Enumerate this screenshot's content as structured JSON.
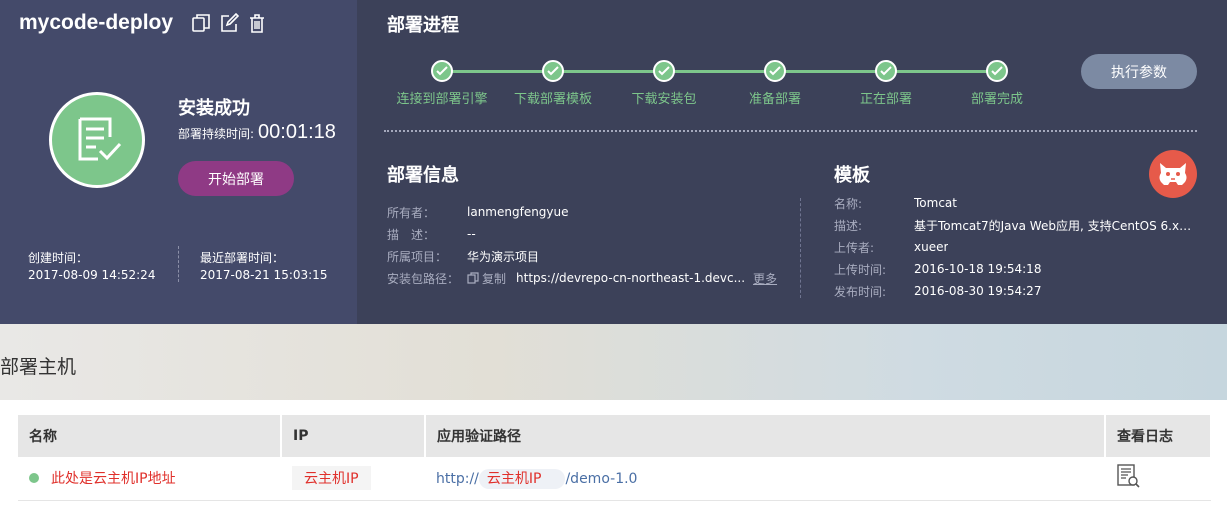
{
  "app": {
    "title": "mycode-deploy",
    "icons": [
      "copy-icon",
      "edit-icon",
      "trash-icon"
    ]
  },
  "status": {
    "title": "安装成功",
    "duration_label": "部署持续时间:",
    "duration_value": "00:01:18",
    "deploy_button": "开始部署",
    "created_label": "创建时间：",
    "created_value": "2017-08-09 14:52:24",
    "last_label": "最近部署时间：",
    "last_value": "2017-08-21 15:03:15"
  },
  "progress": {
    "title": "部署进程",
    "steps": [
      "连接到部署引擎",
      "下载部署模板",
      "下载安装包",
      "准备部署",
      "正在部署",
      "部署完成"
    ],
    "exec_button": "执行参数"
  },
  "info": {
    "title": "部署信息",
    "owner_label": "所有者：",
    "owner_value": "lanmengfengyue",
    "desc_label": "描　述：",
    "desc_value": "--",
    "project_label": "所属项目：",
    "project_value": "华为演示项目",
    "path_label": "安装包路径：",
    "copy_label": "复制",
    "path_value": "https://devrepo-cn-northeast-1.devc...",
    "more_label": "更多"
  },
  "template": {
    "title": "模板",
    "name_label": "名称:",
    "name_value": "Tomcat",
    "desc_label": "描述:",
    "desc_value": "基于Tomcat7的Java Web应用, 支持CentOS 6.x。...",
    "uploader_label": "上传者:",
    "uploader_value": "xueer",
    "upload_time_label": "上传时间:",
    "upload_time_value": "2016-10-18 19:54:18",
    "publish_time_label": "发布时间:",
    "publish_time_value": "2016-08-30 19:54:27"
  },
  "hosts": {
    "title": "部署主机",
    "columns": [
      "名称",
      "IP",
      "应用验证路径",
      "查看日志"
    ],
    "rows": [
      {
        "name": "此处是云主机IP地址",
        "ip": "云主机IP",
        "path_prefix": "http://",
        "path_ip": "云主机IP",
        "path_suffix": "/demo-1.0"
      }
    ]
  },
  "colors": {
    "success": "#7dc68b",
    "deploy_button": "#8f3a85",
    "exec_button": "#7c8aa3",
    "left_panel": "#444a6a",
    "right_panel": "#3c4159",
    "red_text": "#e0302b"
  }
}
